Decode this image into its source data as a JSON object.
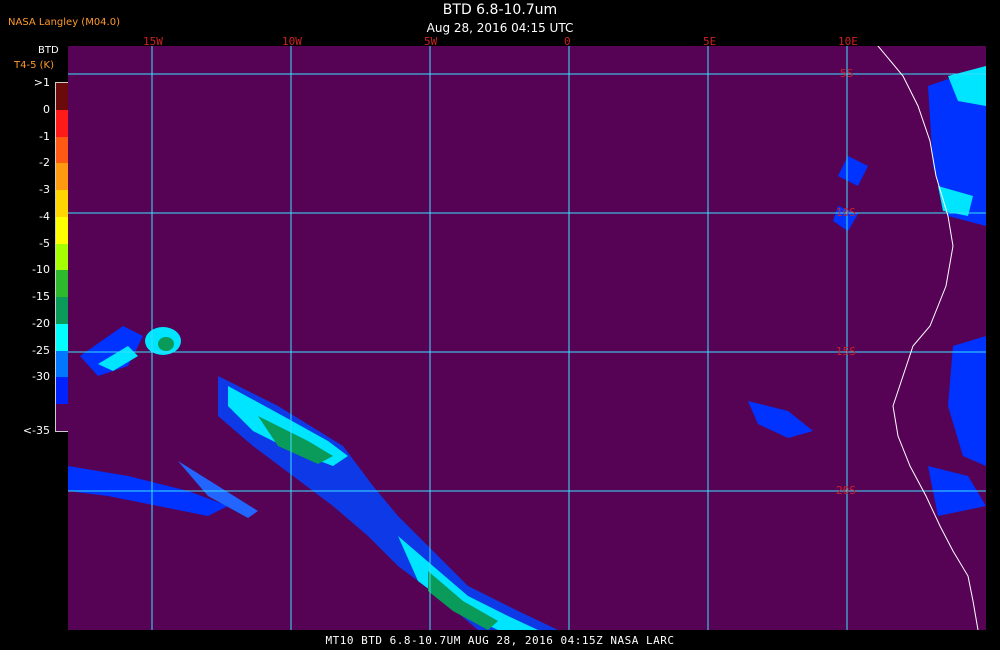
{
  "header": {
    "source": "NASA Langley (M04.0)",
    "title": "BTD 6.8-10.7um",
    "subtitle": "Aug 28, 2016 04:15 UTC"
  },
  "legend": {
    "title": "BTD",
    "subtitle": "T4-5 (K)",
    "ticks": [
      ">1",
      "0",
      "-1",
      "-2",
      "-3",
      "-4",
      "-5",
      "-10",
      "-15",
      "-20",
      "-25",
      "-30",
      "<-35"
    ],
    "colors": [
      "#6a0a0a",
      "#ff1a1a",
      "#ff5a14",
      "#ff9a10",
      "#ffd600",
      "#ffff00",
      "#a6ff00",
      "#2eb82e",
      "#0a9a5a",
      "#00ffff",
      "#0077ff",
      "#0022ff",
      "#560356"
    ]
  },
  "map": {
    "longitude_labels": [
      "15W",
      "10W",
      "5W",
      "0",
      "5E",
      "10E"
    ],
    "latitude_labels": [
      "5S",
      "10S",
      "15S",
      "20S"
    ],
    "background_color": "#560356",
    "grid_color": "#38e0ff",
    "coast_color": "#ffffff"
  },
  "footer": {
    "text": "MT10  BTD 6.8-10.7UM   AUG 28, 2016 04:15Z   NASA LARC"
  }
}
